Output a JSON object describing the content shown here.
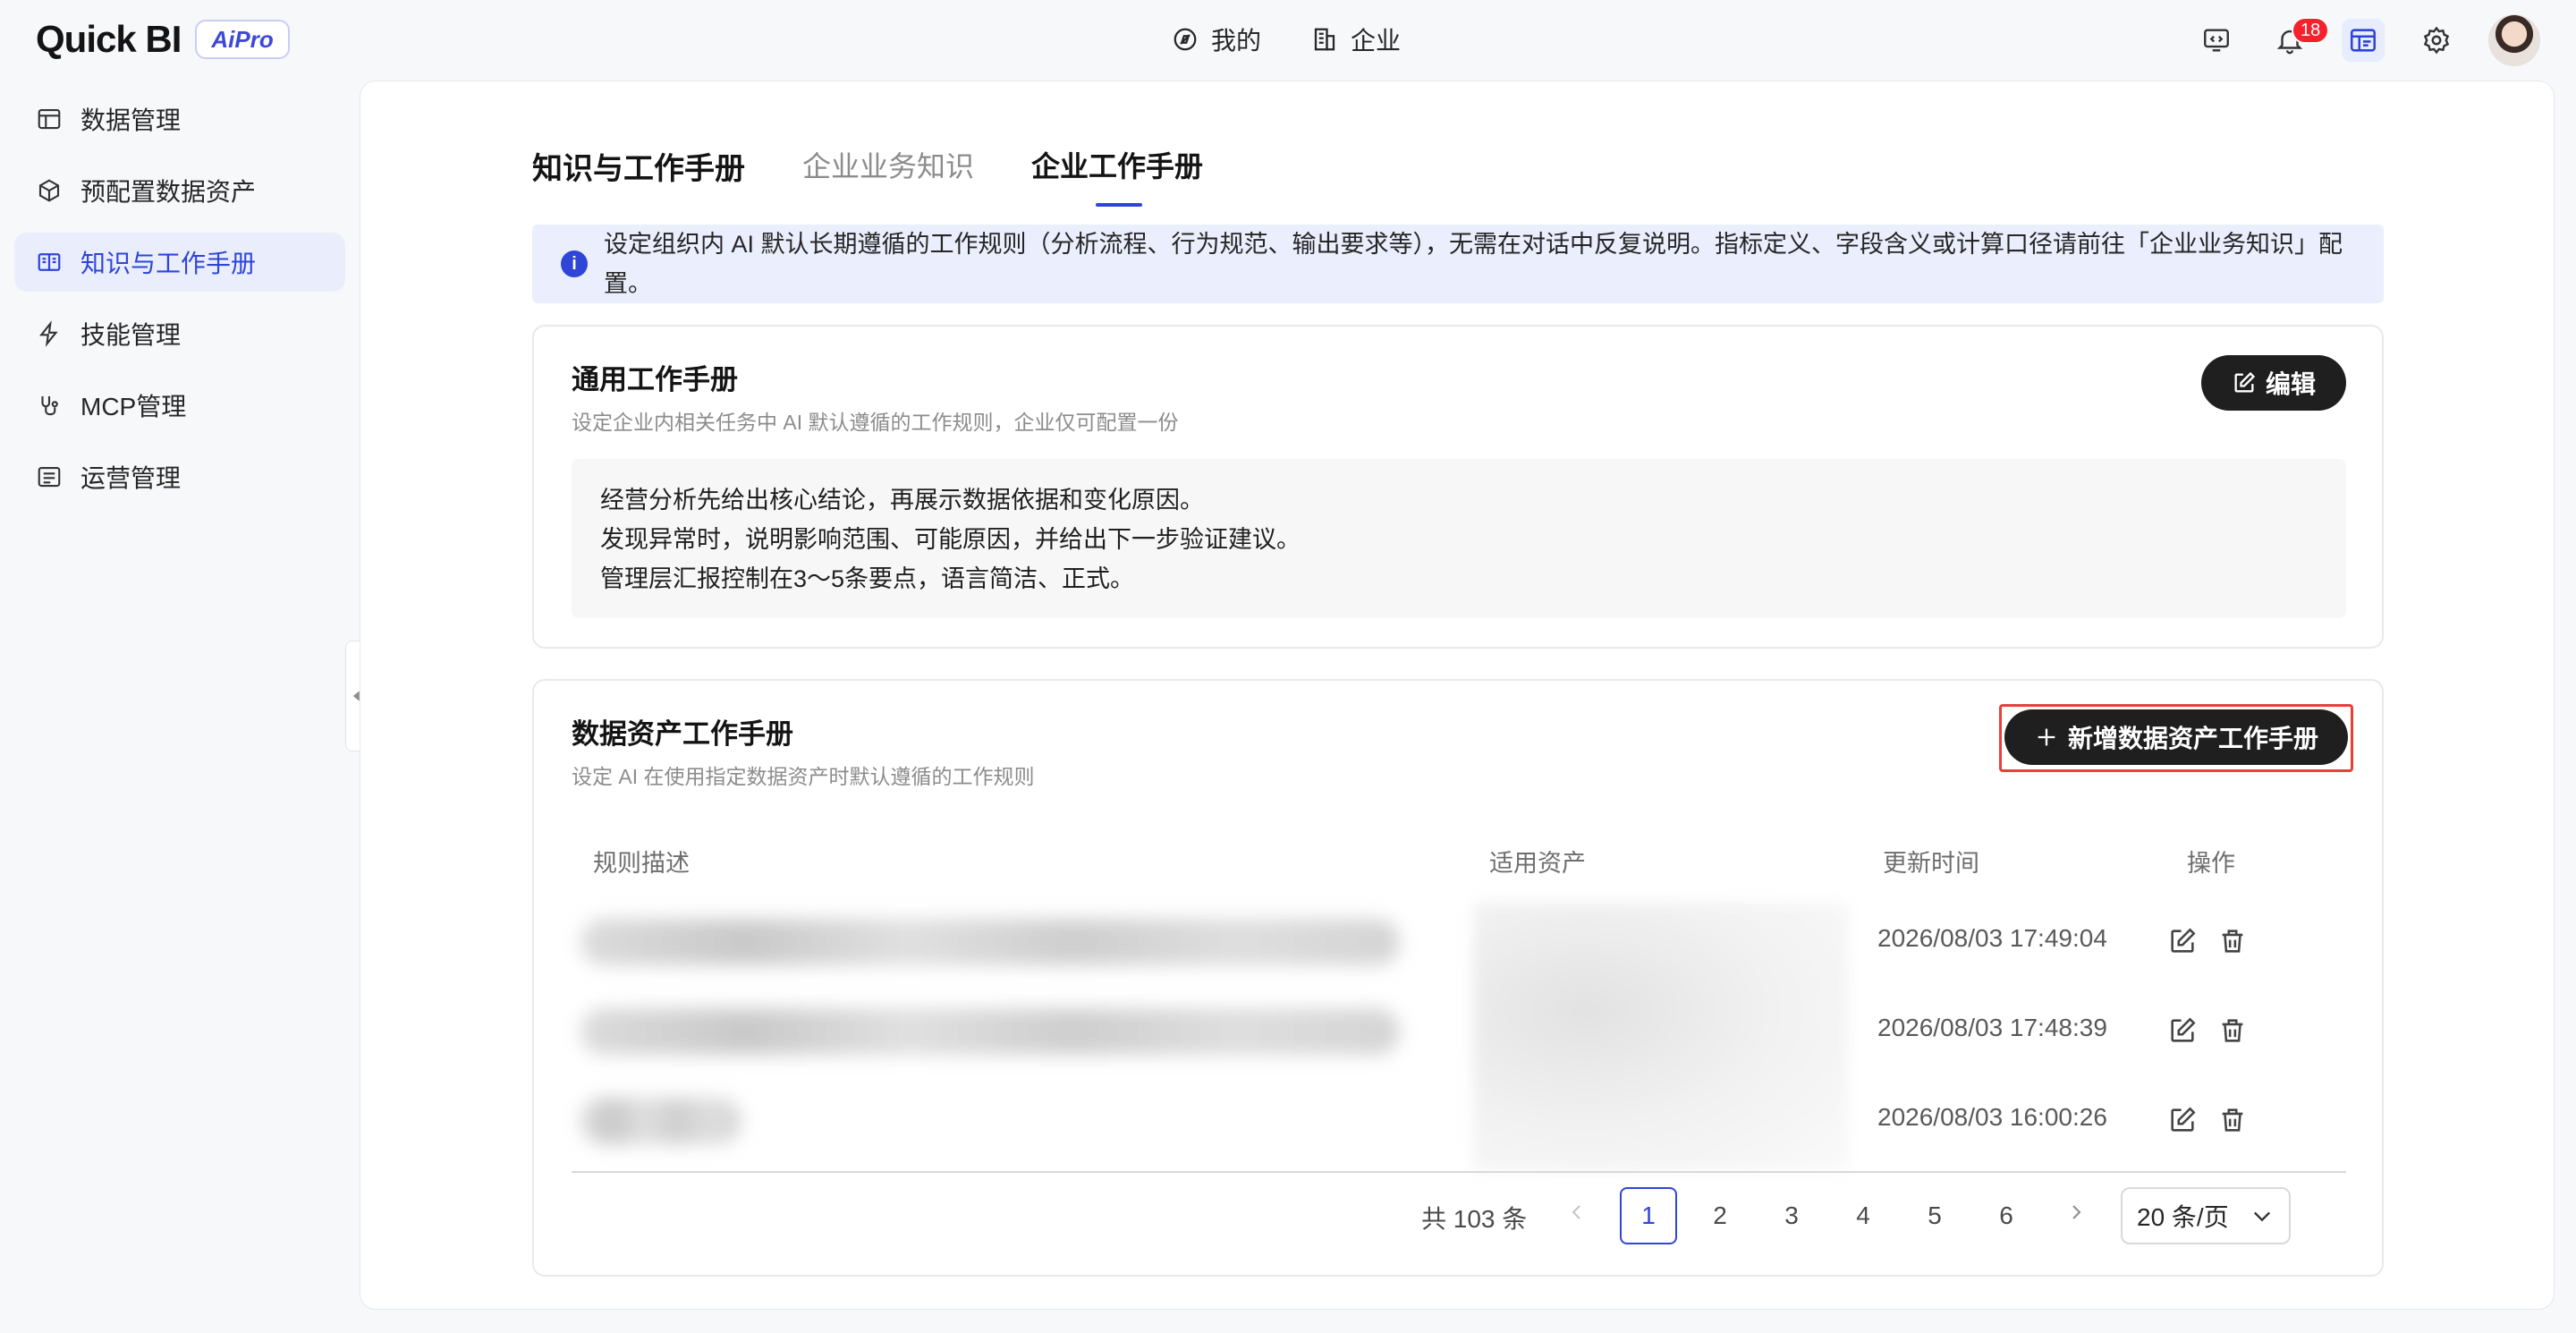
{
  "app": {
    "logo_text": "Quick BI",
    "logo_badge": "AiPro"
  },
  "topnav": [
    {
      "label": "我的",
      "icon": "compass-icon"
    },
    {
      "label": "企业",
      "icon": "building-icon"
    }
  ],
  "topbar": {
    "notification_count": "18"
  },
  "sidebar": {
    "items": [
      {
        "label": "数据管理",
        "icon": "database-table-icon"
      },
      {
        "label": "预配置数据资产",
        "icon": "cube-icon"
      },
      {
        "label": "知识与工作手册",
        "icon": "book-icon",
        "active": true
      },
      {
        "label": "技能管理",
        "icon": "lightning-icon"
      },
      {
        "label": "MCP管理",
        "icon": "plug-icon"
      },
      {
        "label": "运营管理",
        "icon": "list-icon"
      }
    ]
  },
  "tabs": {
    "title": "知识与工作手册",
    "items": [
      "企业业务知识",
      "企业工作手册"
    ],
    "active": "企业工作手册"
  },
  "banner": {
    "text": "设定组织内 AI 默认长期遵循的工作规则（分析流程、行为规范、输出要求等），无需在对话中反复说明。指标定义、字段含义或计算口径请前往「企业业务知识」配置。"
  },
  "general_card": {
    "title": "通用工作手册",
    "desc": "设定企业内相关任务中 AI 默认遵循的工作规则，企业仅可配置一份",
    "edit_label": "编辑",
    "rules": [
      "经营分析先给出核心结论，再展示数据依据和变化原因。",
      "发现异常时，说明影响范围、可能原因，并给出下一步验证建议。",
      "管理层汇报控制在3～5条要点，语言简洁、正式。"
    ]
  },
  "asset_card": {
    "title": "数据资产工作手册",
    "desc": "设定 AI 在使用指定数据资产时默认遵循的工作规则",
    "add_label": "新增数据资产工作手册",
    "columns": [
      "规则描述",
      "适用资产",
      "更新时间",
      "操作"
    ],
    "rows": [
      {
        "updated": "2026/08/03 17:49:04"
      },
      {
        "updated": "2026/08/03 17:48:39"
      },
      {
        "updated": "2026/08/03 16:00:26"
      }
    ]
  },
  "pagination": {
    "total": "共 103 条",
    "pages": [
      "1",
      "2",
      "3",
      "4",
      "5",
      "6"
    ],
    "current": "1",
    "page_size": "20 条/页"
  },
  "colors": {
    "accent": "#2f45d8",
    "dark_button": "#1f1f1f",
    "highlight": "#e8403a",
    "badge": "#f5222d"
  }
}
